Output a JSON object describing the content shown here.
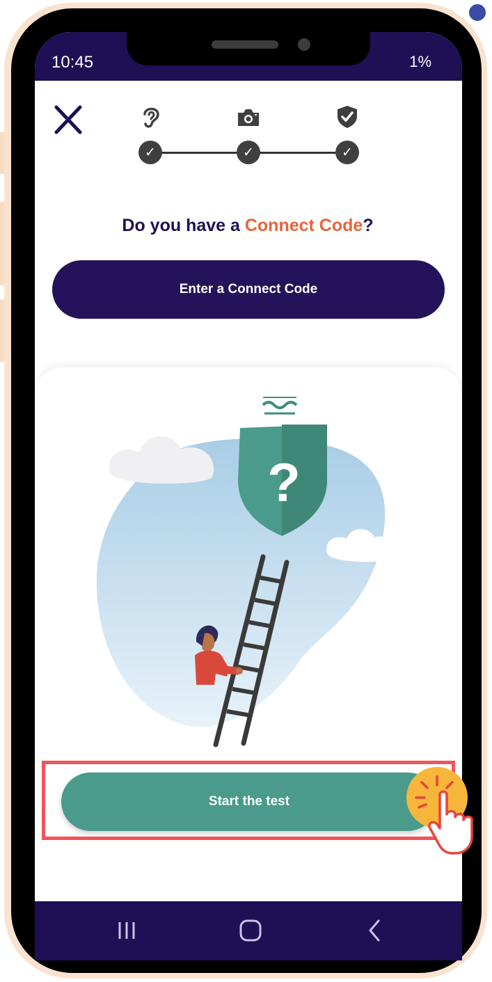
{
  "status_bar": {
    "time": "10:45",
    "right_text": "1%"
  },
  "header": {
    "close_icon": "close-icon",
    "steps": [
      {
        "icon": "ear-icon",
        "completed": true
      },
      {
        "icon": "camera-icon",
        "completed": true
      },
      {
        "icon": "shield-check-icon",
        "completed": true
      }
    ]
  },
  "connect": {
    "question_prefix": "Do you have a ",
    "question_highlight": "Connect Code",
    "question_suffix": "?",
    "button_label": "Enter a Connect Code"
  },
  "illustration": {
    "question_mark": "?"
  },
  "start": {
    "button_label": "Start the test"
  },
  "nav": {
    "items": [
      "recent-apps-icon",
      "home-icon",
      "back-icon"
    ]
  },
  "colors": {
    "brand_dark": "#1f0f54",
    "accent_orange": "#e8643a",
    "primary_green": "#4a9b8b",
    "highlight_red": "#f2545b",
    "step_grey": "#3f3f3f"
  }
}
